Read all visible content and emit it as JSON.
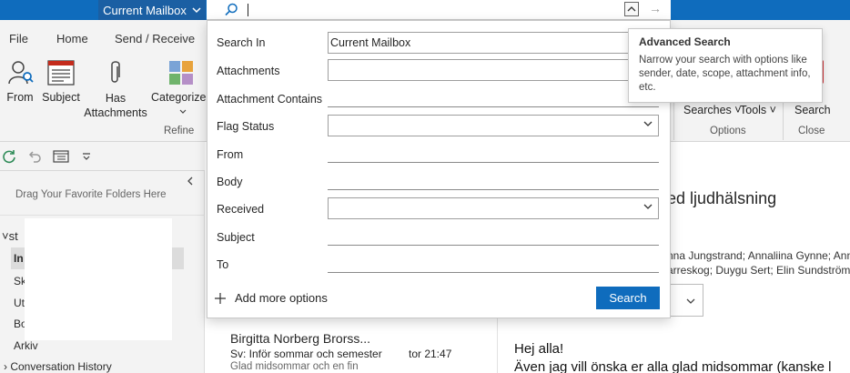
{
  "titlebar": {
    "scope_label": "Current Mailbox",
    "colors": {
      "accent": "#0f6cbd",
      "scope_bg": "#1b5fa3"
    }
  },
  "tabs": [
    "File",
    "Home",
    "Send / Receive"
  ],
  "ribbon": {
    "refine_buttons": [
      {
        "label": "From",
        "icon": "person-search-icon"
      },
      {
        "label": "Subject",
        "icon": "subject-list-icon"
      },
      {
        "label": "Has\nAttachments",
        "icon": "paperclip-icon"
      },
      {
        "label": "Categorized",
        "icon": "categories-grid-icon"
      }
    ],
    "refine_label": "Refine",
    "options": {
      "searches_label": "Searches",
      "tools_label": "Tools",
      "group_label": "Options"
    },
    "close": {
      "button_label": "Search",
      "group_label": "Close"
    }
  },
  "folder_pane": {
    "drag_hint": "Drag Your Favorite Folders Here",
    "account_label": "st",
    "folders": [
      "In",
      "Sk",
      "Ut",
      "Bo",
      "Arkiv",
      "Conversation History"
    ]
  },
  "message_list": {
    "item": {
      "sender": "Birgitta Norberg Brorss...",
      "subject": "Sv: Inför sommar och semester",
      "time": "tor 21:47",
      "preview": "Glad midsommar och en fin"
    }
  },
  "reading_pane": {
    "subject_fragment": "ed ljudhälsning",
    "recipients_line1": "nna Jungstrand; Annaliina Gynne; Ann",
    "recipients_line2": "arreskog; Duygu Sert; Elin Sundström",
    "body_line1": "Hej alla!",
    "body_line2": "Även jag vill önska er alla glad midsommar (kanske l"
  },
  "advanced_search": {
    "fields": [
      {
        "label": "Search In",
        "value": "Current Mailbox",
        "kind": "box"
      },
      {
        "label": "Attachments",
        "value": "",
        "kind": "box"
      },
      {
        "label": "Attachment Contains",
        "value": "",
        "kind": "line"
      },
      {
        "label": "Flag Status",
        "value": "",
        "kind": "dropdown"
      },
      {
        "label": "From",
        "value": "",
        "kind": "line"
      },
      {
        "label": "Body",
        "value": "",
        "kind": "line"
      },
      {
        "label": "Received",
        "value": "",
        "kind": "dropdown"
      },
      {
        "label": "Subject",
        "value": "",
        "kind": "line"
      },
      {
        "label": "To",
        "value": "",
        "kind": "line"
      }
    ],
    "add_more_label": "Add more options",
    "search_button_label": "Search"
  },
  "tooltip": {
    "title": "Advanced Search",
    "body": "Narrow your search with options like sender, date, scope, attachment info, etc."
  }
}
